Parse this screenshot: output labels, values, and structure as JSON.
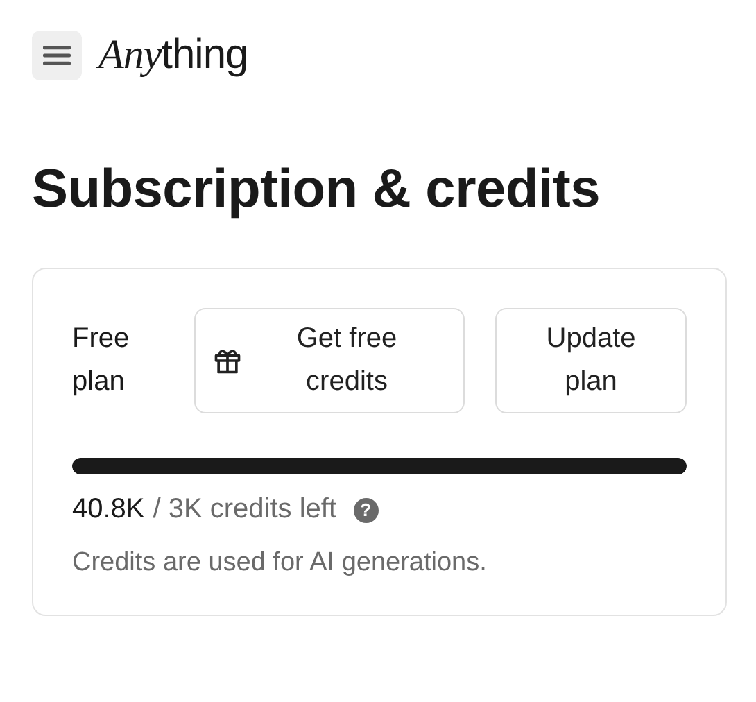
{
  "header": {
    "logo": {
      "italic_part": "Any",
      "rest": "thing"
    }
  },
  "title": "Subscription & credits",
  "card": {
    "plan": "Free plan",
    "buttons": [
      {
        "kind": "gift",
        "label": "Get free credits"
      },
      {
        "kind": "plain",
        "label": "Update plan"
      }
    ],
    "usage": {
      "level": 1,
      "used": "40.8K",
      "rest": "/ 3K credits left",
      "help": "?"
    },
    "note": "Credits are used for AI generations."
  }
}
